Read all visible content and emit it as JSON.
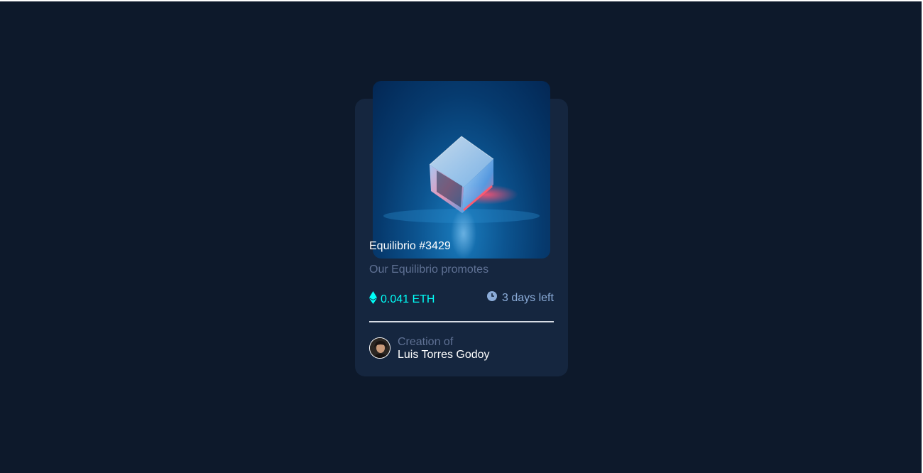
{
  "card": {
    "title": "Equilibrio #3429",
    "description": "Our Equilibrio promotes",
    "price": "0.041 ETH",
    "time_left": "3 days left",
    "creator_label": "Creation of",
    "creator_name": "Luis Torres Godoy"
  },
  "icons": {
    "price": "ethereum-icon",
    "time": "clock-icon",
    "avatar": "avatar-image"
  },
  "colors": {
    "background": "#0d192b",
    "card": "#15263f",
    "cyan": "#00fff8",
    "soft_blue": "#8bacd9",
    "muted": "#5f7194",
    "white": "#ffffff"
  }
}
